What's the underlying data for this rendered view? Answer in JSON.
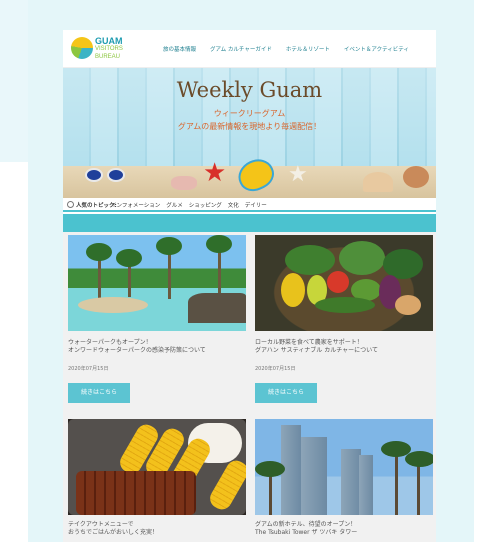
{
  "header": {
    "logo_text": "GUAM",
    "logo_sub1": "VISITORS",
    "logo_sub2": "BUREAU",
    "nav": [
      "旅の基本情報",
      "グアム カルチャーガイド",
      "ホテル＆リゾート",
      "イベント＆アクティビティ"
    ]
  },
  "hero": {
    "title": "Weekly Guam",
    "subtitle1": "ウィークリーグアム",
    "subtitle2": "グアムの最新情報を現地より毎週配信！"
  },
  "topics": {
    "label": "人気のトピック:",
    "items": [
      "インフォメーション",
      "グルメ",
      "ショッピング",
      "文化",
      "デイリー"
    ]
  },
  "articles": [
    {
      "title_line1": "ウォーターパークもオープン！",
      "title_line2": "オンワードウォーターパークの感染予防策について",
      "date": "2020年07月15日",
      "button": "続きはこちら"
    },
    {
      "title_line1": "ローカル野菜を食べて農家をサポート！",
      "title_line2": "グアハン サスティナブル カルチャーについて",
      "date": "2020年07月15日",
      "button": "続きはこちら"
    },
    {
      "title_line1": "テイクアウトメニューで",
      "title_line2": "おうちでごはんがおいしく充実！",
      "date": "",
      "button": ""
    },
    {
      "title_line1": "グアムの新ホテル、待望のオープン！",
      "title_line2": "The Tsubaki Tower ザ ツバキ タワー",
      "date": "",
      "button": ""
    }
  ],
  "colors": {
    "accent": "#4bc2cf",
    "button": "#5cc4d2",
    "hero_text": "#d9642a"
  }
}
